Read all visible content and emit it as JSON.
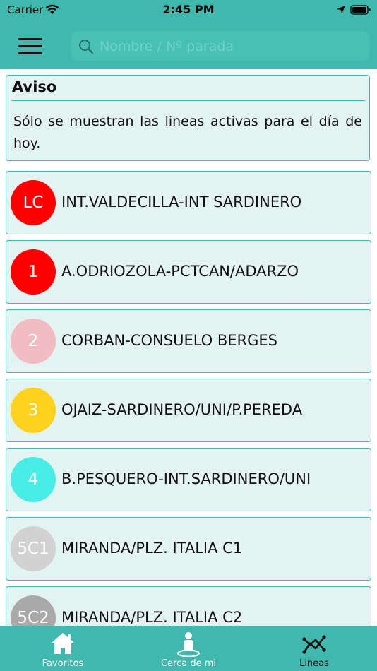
{
  "status_bar": {
    "carrier": "Carrier",
    "time": "2:45 PM"
  },
  "search": {
    "placeholder": "Nombre / Nº parada"
  },
  "notice": {
    "title": "Aviso",
    "body": "Sólo se muestran las lineas activas para el día de hoy."
  },
  "lines": [
    {
      "code": "LC",
      "name": "INT.VALDECILLA-INT SARDINERO",
      "color": "#ff0000"
    },
    {
      "code": "1",
      "name": "A.ODRIOZOLA-PCTCAN/ADARZO",
      "color": "#ff0000"
    },
    {
      "code": "2",
      "name": "CORBAN-CONSUELO BERGES",
      "color": "#f2bcc3"
    },
    {
      "code": "3",
      "name": "OJAIZ-SARDINERO/UNI/P.PEREDA",
      "color": "#ffd21f"
    },
    {
      "code": "4",
      "name": "B.PESQUERO-INT.SARDINERO/UNI",
      "color": "#47eee6"
    },
    {
      "code": "5C1",
      "name": "MIRANDA/PLZ. ITALIA C1",
      "color": "#d2d2d2"
    },
    {
      "code": "5C2",
      "name": "MIRANDA/PLZ. ITALIA C2",
      "color": "#a9a9a9"
    }
  ],
  "tabs": [
    {
      "label": "Favoritos",
      "icon": "house-icon",
      "active": false
    },
    {
      "label": "Cerca de mi",
      "icon": "person-location-icon",
      "active": false
    },
    {
      "label": "Lineas",
      "icon": "route-icon",
      "active": true
    }
  ],
  "colors": {
    "accent": "#3fb8ad",
    "card_background": "#e3f3f1"
  }
}
